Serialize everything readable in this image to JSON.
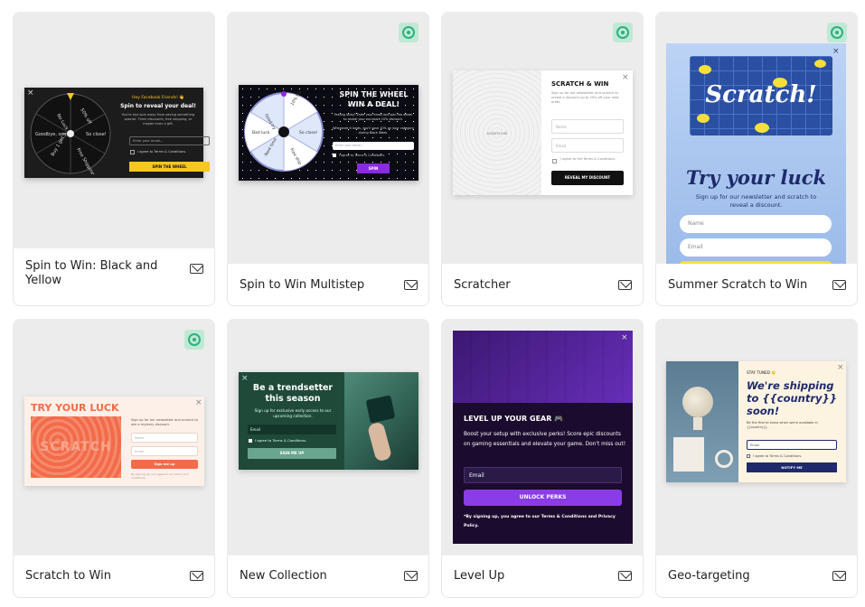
{
  "colors": {
    "card_bg": "#ececec",
    "badge_green": "#2fb07a",
    "yellow": "#f6c622",
    "purple": "#8a2be2",
    "dark_green": "#1f4a3a",
    "navy": "#1e2a6b",
    "coral": "#f26b4a"
  },
  "cards": [
    {
      "title": "Spin to Win: Black and Yellow",
      "has_badge": false,
      "preview": {
        "kicker": "Hey Facebook Friends! 👋",
        "heading": "Spin to reveal your deal!",
        "body": "You're one spin away from saving something special. Think discounts, free shipping, or maybe even a gift.",
        "input_placeholder": "Enter your email...",
        "consent": "I agree to Terms & Conditions.",
        "button": "SPIN THE WHEEL",
        "wheel_labels": [
          "No Luck",
          "50% off",
          "So close!",
          "Free Shipping",
          "Buy 1 get 1",
          "Goodbye, sorry"
        ]
      }
    },
    {
      "title": "Spin to Win Multistep",
      "has_badge": true,
      "preview": {
        "heading1": "SPIN THE WHEEL",
        "heading2": "WIN A DEAL!",
        "body": "Feeling lucky? Enter your email and spin the wheel to reveal your exclusive 10% discount.",
        "body2": "Whenever it lands, you'll save 10% on your category during Black Week.",
        "input_placeholder": "Enter your email...",
        "consent": "I agree to Terms & Conditions.",
        "button": "SPIN",
        "wheel_labels": [
          "10% Discount",
          "So close!",
          "Free ship",
          "Next time",
          "Bad luck",
          "Good try"
        ]
      }
    },
    {
      "title": "Scratcher",
      "has_badge": true,
      "preview": {
        "scratch_label": "SCRATCH ME",
        "heading": "SCRATCH & WIN",
        "body": "Sign up for our newsletter and scratch to reveal a discount up to 20% off your next order.",
        "name_placeholder": "Name",
        "email_placeholder": "Email",
        "consent": "I agree to the Terms & Conditions.",
        "button": "REVEAL MY DISCOUNT"
      }
    },
    {
      "title": "Summer Scratch to Win",
      "has_badge": true,
      "preview": {
        "scratch_word": "Scratch!",
        "heading": "Try your luck",
        "body": "Sign up for our newsletter and scratch to reveal a discount.",
        "name_placeholder": "Name",
        "email_placeholder": "Email"
      }
    },
    {
      "title": "Scratch to Win",
      "has_badge": true,
      "preview": {
        "heading": "TRY YOUR LUCK",
        "scratch_word": "SCRATCH",
        "body": "Sign up for our newsletter and scratch to win a mystery discount.",
        "name_placeholder": "Name",
        "email_placeholder": "Email",
        "button": "Sign me up",
        "footnote": "By signing up, you agree to our terms and conditions."
      }
    },
    {
      "title": "New Collection",
      "has_badge": false,
      "preview": {
        "heading": "Be a trendsetter this season",
        "body": "Sign up for exclusive early access to our upcoming collection.",
        "email_placeholder": "Email",
        "consent": "I agree to Terms & Conditions.",
        "button": "SIGN ME UP"
      }
    },
    {
      "title": "Level Up",
      "has_badge": false,
      "preview": {
        "heading": "LEVEL UP YOUR GEAR 🎮",
        "body": "Boost your setup with exclusive perks! Score epic discounts on gaming essentials and elevate your game. Don't miss out!",
        "email_placeholder": "Email",
        "button": "UNLOCK PERKS",
        "footnote": "*By signing up, you agree to our Terms & Conditions and Privacy Policy."
      }
    },
    {
      "title": "Geo-targeting",
      "has_badge": false,
      "preview": {
        "kicker": "STAY TUNED 👋",
        "heading": "We're shipping to {{country}} soon!",
        "body": "Be the first to know when we're available in {{country}}.",
        "email_placeholder": "Email",
        "consent": "I agree to Terms & Conditions.",
        "button": "NOTIFY ME"
      }
    }
  ]
}
